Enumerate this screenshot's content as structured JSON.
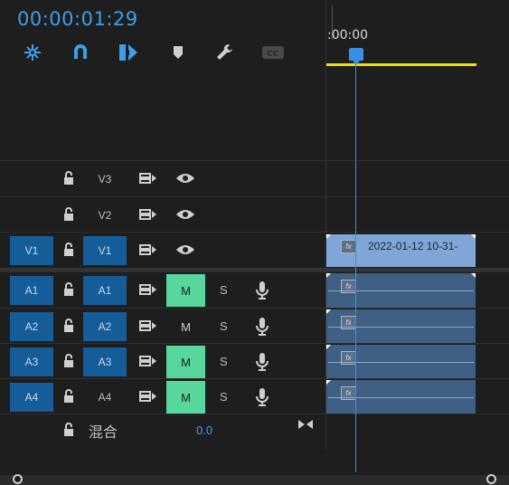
{
  "timecode": "00:00:01:29",
  "ruler": {
    "time_label": ":00:00"
  },
  "toolbar": {
    "icons": [
      "snap-icon",
      "linked-selection-icon",
      "insert-overwrite-icon",
      "add-marker-icon",
      "settings-wrench-icon",
      "captions-icon"
    ]
  },
  "tracks": {
    "v3": {
      "label": "V3"
    },
    "v2": {
      "label": "V2"
    },
    "v1": {
      "source": "V1",
      "label": "V1",
      "clip_name": "2022-01-12 10-31-"
    },
    "a1": {
      "source": "A1",
      "label": "A1",
      "mute": "M",
      "solo": "S"
    },
    "a2": {
      "source": "A2",
      "label": "A2",
      "mute": "M",
      "solo": "S"
    },
    "a3": {
      "source": "A3",
      "label": "A3",
      "mute": "M",
      "solo": "S"
    },
    "a4": {
      "source": "A4",
      "label": "A4",
      "mute": "M",
      "solo": "S"
    }
  },
  "clip_fx": "fx",
  "mix": {
    "label": "混合",
    "value": "0.0"
  },
  "colors": {
    "accent_blue": "#3aa0ea",
    "work_area_yellow": "#f2e100",
    "mute_on_green": "#57d79c",
    "patch_blue": "#155d99",
    "video_clip": "#7fa6d6",
    "audio_clip": "#3f5f84"
  }
}
